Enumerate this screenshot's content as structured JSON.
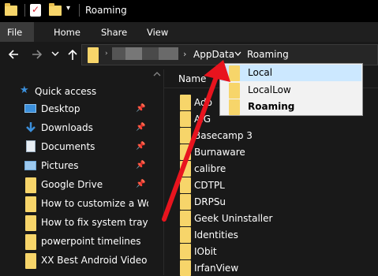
{
  "window": {
    "title": "Roaming"
  },
  "ribbon": {
    "file": "File",
    "tabs": [
      "Home",
      "Share",
      "View"
    ]
  },
  "breadcrumb": {
    "items": [
      "AppData",
      "Roaming"
    ]
  },
  "nav": {
    "quick_access": "Quick access",
    "items": [
      {
        "label": "Desktop",
        "icon": "desktop-icon",
        "pinned": true
      },
      {
        "label": "Downloads",
        "icon": "download-icon",
        "pinned": true
      },
      {
        "label": "Documents",
        "icon": "documents-icon",
        "pinned": true
      },
      {
        "label": "Pictures",
        "icon": "pictures-icon",
        "pinned": true
      },
      {
        "label": "Google Drive",
        "icon": "folder-icon",
        "pinned": true
      },
      {
        "label": "How to customize a Word",
        "icon": "folder-icon",
        "pinned": false
      },
      {
        "label": "How to fix system tray or",
        "icon": "folder-icon",
        "pinned": false
      },
      {
        "label": "powerpoint timelines",
        "icon": "folder-icon",
        "pinned": false
      },
      {
        "label": "XX Best Android Video Pla",
        "icon": "folder-icon",
        "pinned": false
      }
    ]
  },
  "content": {
    "column_name": "Name",
    "rows": [
      "Ado",
      "AIG",
      "Basecamp 3",
      "Burnaware",
      "calibre",
      "CDTPL",
      "DRPSu",
      "Geek Uninstaller",
      "Identities",
      "IObit",
      "IrfanView"
    ]
  },
  "dropdown": {
    "items": [
      {
        "label": "Local",
        "highlighted": true
      },
      {
        "label": "LocalLow",
        "highlighted": false
      },
      {
        "label": "Roaming",
        "highlighted": false,
        "bold": true
      }
    ]
  },
  "colors": {
    "folder": "#f7d56a",
    "highlight": "#cce8ff",
    "arrow": "#e8141e",
    "accent": "#3b8fdb"
  }
}
